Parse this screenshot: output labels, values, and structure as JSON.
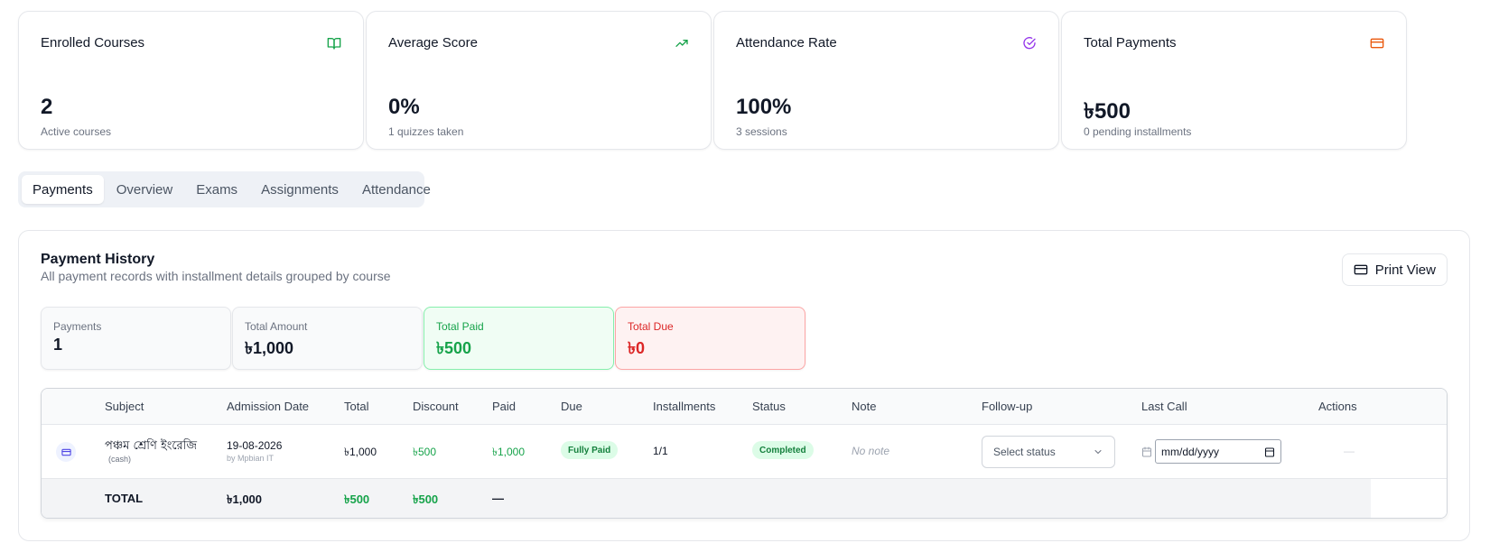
{
  "stats": [
    {
      "title": "Enrolled Courses",
      "value": "2",
      "sub": "Active courses",
      "icon": "book-open-icon",
      "color": "#16a34a"
    },
    {
      "title": "Average Score",
      "value": "0%",
      "sub": "1 quizzes taken",
      "icon": "trending-up-icon",
      "color": "#16a34a"
    },
    {
      "title": "Attendance Rate",
      "value": "100%",
      "sub": "3 sessions",
      "icon": "check-circle-icon",
      "color": "#9333ea"
    },
    {
      "title": "Total Payments",
      "value": "৳500",
      "sub": "0 pending installments",
      "icon": "credit-card-icon",
      "color": "#ea580c"
    }
  ],
  "tabs": [
    "Payments",
    "Overview",
    "Exams",
    "Assignments",
    "Attendance"
  ],
  "active_tab": "Payments",
  "panel": {
    "title": "Payment History",
    "description": "All payment records with installment details grouped by course",
    "print_label": "Print View"
  },
  "summary": [
    {
      "label": "Payments",
      "value": "1"
    },
    {
      "label": "Total Amount",
      "value": "৳1,000"
    },
    {
      "label": "Total Paid",
      "value": "৳500"
    },
    {
      "label": "Total Due",
      "value": "৳0"
    }
  ],
  "table": {
    "headers": [
      "Subject",
      "Admission Date",
      "Total",
      "Discount",
      "Paid",
      "Due",
      "Installments",
      "Status",
      "Note",
      "Follow-up",
      "Last Call",
      "Actions"
    ],
    "row": {
      "subject": "পঞ্চম শ্রেণি ইংরেজি",
      "method": "(cash)",
      "admission_date": "19-08-2026",
      "admission_by": "by Mpbian IT",
      "total": "৳1,000",
      "discount": "৳500",
      "paid": "৳1,000",
      "due": "Fully Paid",
      "installments": "1/1",
      "status": "Completed",
      "note": "No note",
      "followup_placeholder": "Select status",
      "last_call_placeholder": "mm/dd/yyyy",
      "actions": "—"
    },
    "totals": {
      "label": "TOTAL",
      "total": "৳1,000",
      "discount": "৳500",
      "paid": "৳500",
      "due": "—"
    }
  },
  "colors": {
    "accent_green": "#16a34a",
    "due_red": "#dc2626",
    "brand_blue": "#4f46e5"
  }
}
